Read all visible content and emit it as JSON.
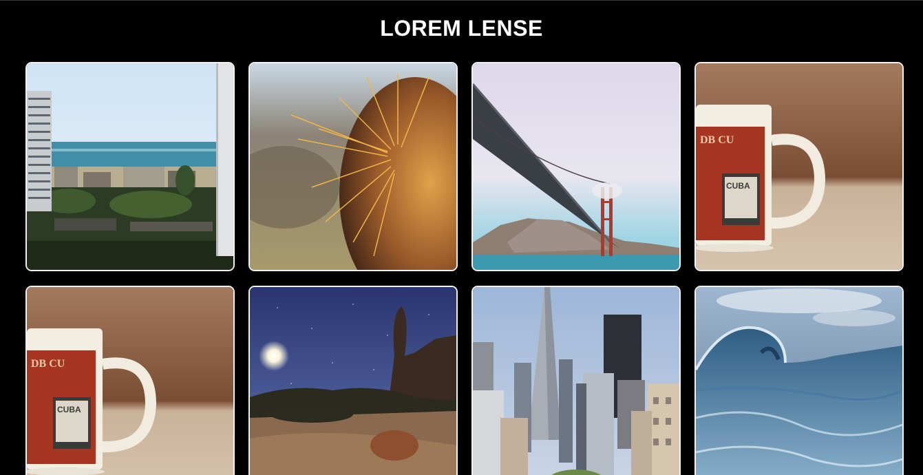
{
  "header": {
    "title": "LOREM LENSE"
  },
  "gallery": {
    "photos": [
      {
        "subject": "coastal-city-view"
      },
      {
        "subject": "cactus-closeup"
      },
      {
        "subject": "golden-gate-bridge"
      },
      {
        "subject": "stamp-mug"
      },
      {
        "subject": "stamp-mug"
      },
      {
        "subject": "desert-night-sky"
      },
      {
        "subject": "city-skyline"
      },
      {
        "subject": "ocean-wave"
      }
    ]
  },
  "colors": {
    "background": "#000000",
    "title_text": "#ffffff",
    "tile_border": "#f2f2f2"
  }
}
